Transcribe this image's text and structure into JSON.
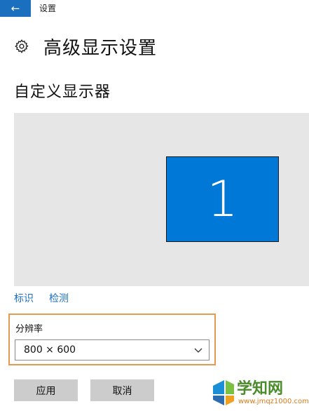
{
  "window": {
    "title": "设置"
  },
  "header": {
    "title": "高级显示设置"
  },
  "section": {
    "title": "自定义显示器"
  },
  "display": {
    "monitor_number": "1"
  },
  "links": {
    "identify": "标识",
    "detect": "检测"
  },
  "resolution": {
    "label": "分辨率",
    "value": "800 × 600"
  },
  "buttons": {
    "apply": "应用",
    "cancel": "取消"
  },
  "watermark": {
    "text": "学知网",
    "url": "www.jmqz1000.com"
  },
  "colors": {
    "accent": "#1a6fbf",
    "monitor": "#0078d7",
    "highlight_border": "#e59a53",
    "button_bg": "#cccccc",
    "display_bg": "#e6e6e6"
  },
  "icons": {
    "back": "back-arrow-icon",
    "settings": "gear-icon",
    "dropdown": "chevron-down-icon"
  }
}
